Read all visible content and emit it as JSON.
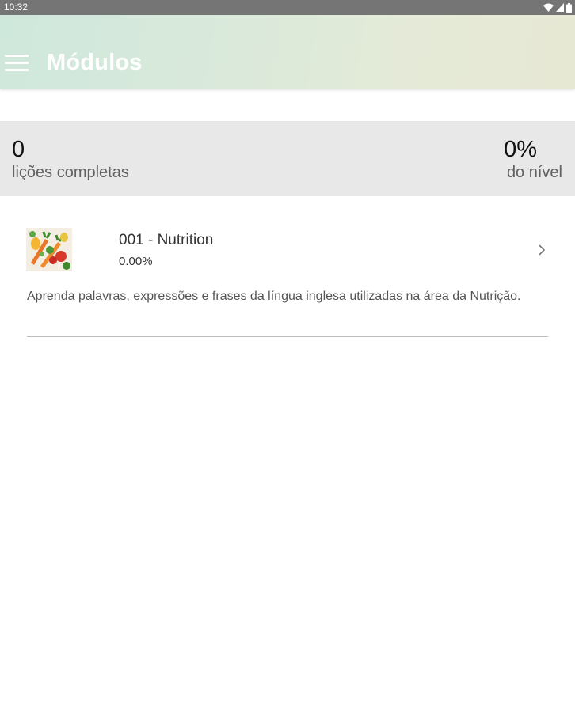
{
  "status_bar": {
    "time": "10:32",
    "icons": [
      "wifi-icon",
      "signal-icon",
      "battery-icon"
    ]
  },
  "app_bar": {
    "title": "Módulos",
    "menu_icon": "hamburger-menu-icon"
  },
  "stats": {
    "lessons_completed_value": "0",
    "lessons_completed_label": "lições completas",
    "level_percent_value": "0%",
    "level_percent_label": "do nível"
  },
  "modules": [
    {
      "title": "001 - Nutrition",
      "progress": "0.00%",
      "description": "Aprenda palavras, expressões e frases da língua inglesa utilizadas na área da Nutrição.",
      "thumbnail": "vegetables-image",
      "action_icon": "chevron-right-icon"
    }
  ],
  "colors": {
    "status_bar": "#757575",
    "app_bar_gradient_start": "#cfe8dc",
    "app_bar_gradient_end": "#e6e8d4",
    "stats_band": "#e8e8e8"
  }
}
